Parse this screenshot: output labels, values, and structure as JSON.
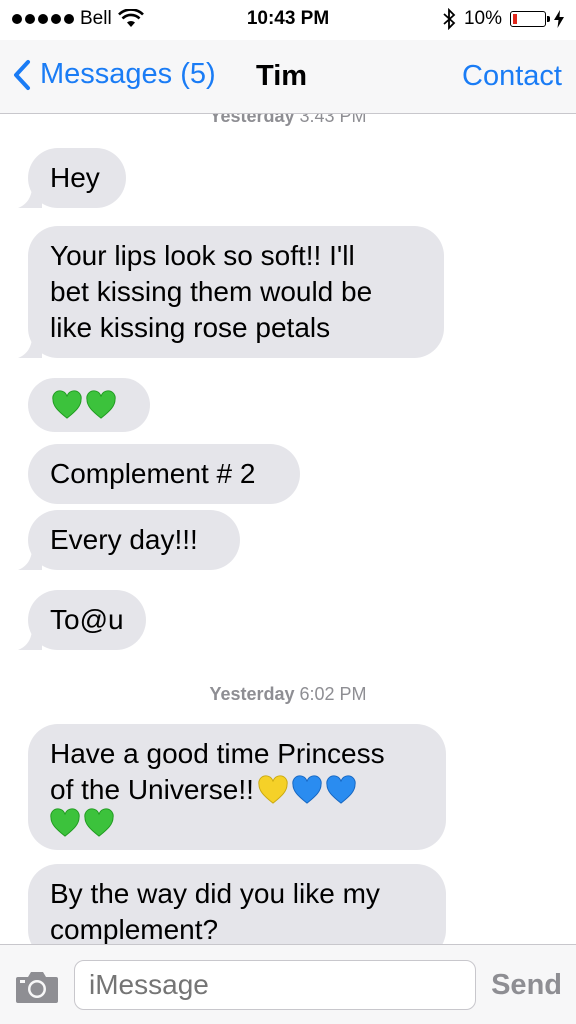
{
  "status_bar": {
    "carrier": "Bell",
    "time": "10:43 PM",
    "battery_percent": "10%",
    "battery_level": 0.1
  },
  "nav": {
    "back_label": "Messages (5)",
    "title": "Tim",
    "contact_label": "Contact"
  },
  "timestamps": [
    {
      "day": "Yesterday",
      "time": "3:43 PM"
    },
    {
      "day": "Yesterday",
      "time": "6:02 PM"
    }
  ],
  "messages": [
    {
      "text": "Hey"
    },
    {
      "lines": [
        "Your lips look so soft!! I'll",
        "bet kissing them would be",
        "like kissing rose petals"
      ]
    },
    {
      "emoji": [
        "green-heart",
        "green-heart"
      ]
    },
    {
      "text": "Complement # 2"
    },
    {
      "text": "Every day!!!"
    },
    {
      "text": "To@u"
    },
    {
      "line1": "Have a good time Princess",
      "line2": "of the Universe!!",
      "line2_emoji": [
        "yellow-heart",
        "blue-heart",
        "blue-heart"
      ],
      "line3_emoji": [
        "green-heart",
        "green-heart"
      ]
    },
    {
      "lines": [
        "By the way did you like my",
        "complement?"
      ]
    }
  ],
  "colors": {
    "accent": "#1a7cf5",
    "bubble": "#e5e5ea",
    "green_heart": "#3cc23c",
    "blue_heart": "#2a8cf0",
    "yellow_heart": "#f5d128"
  },
  "input": {
    "placeholder": "iMessage",
    "send_label": "Send"
  }
}
